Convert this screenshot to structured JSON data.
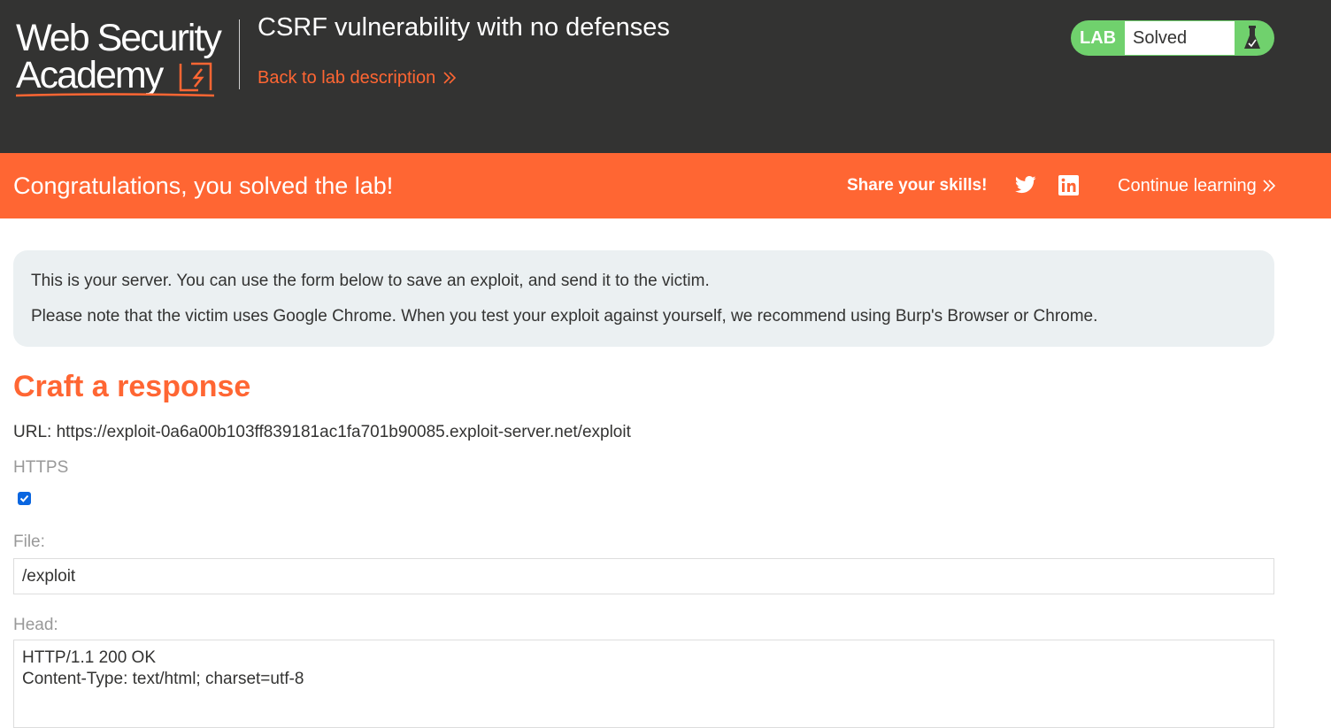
{
  "header": {
    "logo_line1": "Web Security",
    "logo_line2": "Academy",
    "lab_title": "CSRF vulnerability with no defenses",
    "back_link": "Back to lab description",
    "lab_tag": "LAB",
    "lab_status": "Solved"
  },
  "banner": {
    "message": "Congratulations, you solved the lab!",
    "share_label": "Share your skills!",
    "continue_label": "Continue learning"
  },
  "info": {
    "line1": "This is your server. You can use the form below to save an exploit, and send it to the victim.",
    "line2": "Please note that the victim uses Google Chrome. When you test your exploit against yourself, we recommend using Burp's Browser or Chrome."
  },
  "form": {
    "section_title": "Craft a response",
    "url_line": "URL: https://exploit-0a6a00b103ff839181ac1fa701b90085.exploit-server.net/exploit",
    "https_label": "HTTPS",
    "https_checked": true,
    "file_label": "File:",
    "file_value": "/exploit",
    "head_label": "Head:",
    "head_value": "HTTP/1.1 200 OK\nContent-Type: text/html; charset=utf-8"
  },
  "colors": {
    "header_bg": "#333332",
    "accent_orange": "#ff6633",
    "solved_green": "#70d16d",
    "info_bg": "#ebf0f2",
    "checkbox_blue": "#0a66e0"
  },
  "icons": {
    "logo_mark": "lightning-bolt-icon",
    "back_chevrons": "double-chevron-right-icon",
    "flask": "flask-icon",
    "share_twitter": "twitter-icon",
    "share_linkedin": "linkedin-icon",
    "continue_chevrons": "double-chevron-right-icon"
  }
}
